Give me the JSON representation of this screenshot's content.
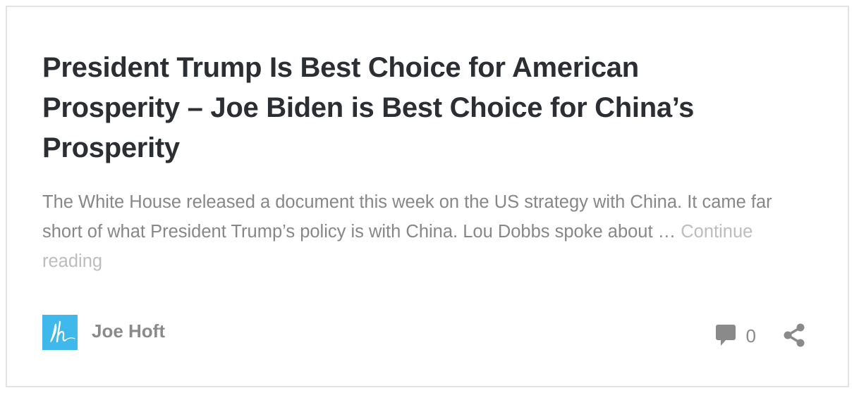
{
  "post": {
    "title": "President Trump Is Best Choice for American Prosperity – Joe Biden is Best Choice for China’s Prosperity",
    "excerpt": "The White House released a document this week on the US strategy with China. It came far short of what President Trump’s policy is with China. Lou Dobbs spoke about … ",
    "continue_label": "Continue reading"
  },
  "author": {
    "name": "Joe Hoft",
    "avatar_initials": "Jh",
    "avatar_color": "#3fb8ec"
  },
  "meta": {
    "comment_count": "0",
    "comment_icon": "comment-bubble-icon",
    "share_icon": "share-icon"
  },
  "colors": {
    "title": "#2b2f33",
    "text": "#878787",
    "link": "#bdbdbd",
    "border": "#e3e3e3"
  }
}
